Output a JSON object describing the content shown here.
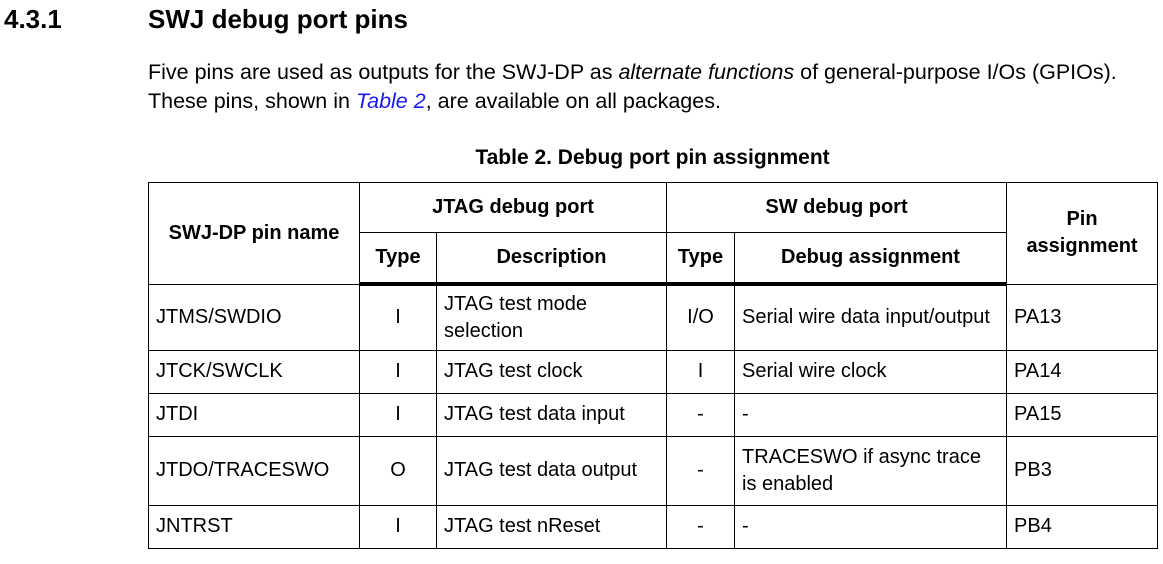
{
  "section": {
    "number": "4.3.1",
    "title": "SWJ debug port pins"
  },
  "paragraph": {
    "part1": "Five pins are used as outputs for the SWJ-DP as ",
    "emphasis": "alternate functions",
    "part2": " of general-purpose I/Os (GPIOs). These pins, shown in ",
    "link": "Table 2",
    "part3": ", are available on all packages."
  },
  "table": {
    "caption": "Table 2. Debug port pin assignment",
    "headers": {
      "pin_name": "SWJ-DP pin name",
      "jtag_group": "JTAG debug port",
      "sw_group": "SW debug port",
      "pin_assignment": "Pin assignment",
      "jtag_type": "Type",
      "jtag_description": "Description",
      "sw_type": "Type",
      "sw_debug_assignment": "Debug assignment"
    },
    "rows": [
      {
        "pin": "JTMS/SWDIO",
        "jtag_type": "I",
        "jtag_desc": "JTAG test mode selection",
        "sw_type": "I/O",
        "sw_desc": "Serial wire data input/output",
        "assign": "PA13"
      },
      {
        "pin": "JTCK/SWCLK",
        "jtag_type": "I",
        "jtag_desc": "JTAG test clock",
        "sw_type": "I",
        "sw_desc": "Serial wire clock",
        "assign": "PA14"
      },
      {
        "pin": "JTDI",
        "jtag_type": "I",
        "jtag_desc": "JTAG test data input",
        "sw_type": "-",
        "sw_desc": "-",
        "assign": "PA15"
      },
      {
        "pin": "JTDO/TRACESWO",
        "jtag_type": "O",
        "jtag_desc": "JTAG test data output",
        "sw_type": "-",
        "sw_desc": "TRACESWO if async trace is enabled",
        "assign": "PB3"
      },
      {
        "pin": "JNTRST",
        "jtag_type": "I",
        "jtag_desc": "JTAG test nReset",
        "sw_type": "-",
        "sw_desc": "-",
        "assign": "PB4"
      }
    ]
  },
  "colors": {
    "link": "#1a1aee",
    "text": "#000000",
    "background": "#ffffff"
  }
}
